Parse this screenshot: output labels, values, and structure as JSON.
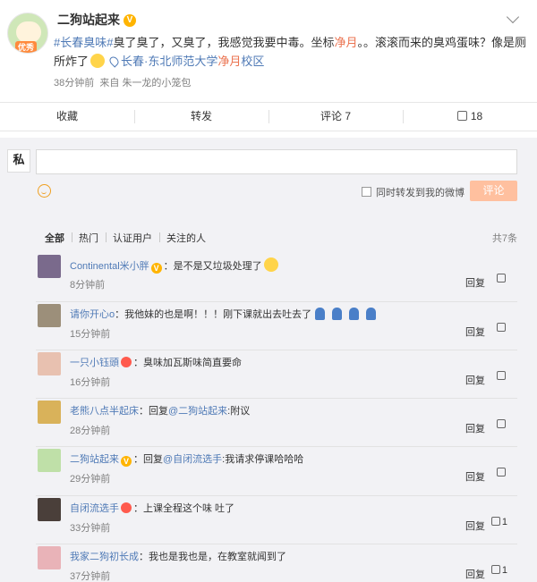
{
  "post": {
    "author": "二狗站起来",
    "verified_mark": "V",
    "avatar_tag": "优秀",
    "text_hashtag": "#长春臭味#",
    "text_1": "臭了臭了，又臭了，我感觉我要中毒。坐标",
    "text_hl": "净月",
    "text_2": "。。滚滚而来的臭鸡蛋味？像是厕所炸了",
    "location_a": "长春·东北师范大学",
    "location_b": "净月",
    "location_c": "校区",
    "time": "38分钟前",
    "source_prefix": "来自",
    "source": "朱一龙的小笼包"
  },
  "actions": {
    "favorite": "收藏",
    "repost": "转发",
    "comment": "评论 7",
    "like": "18"
  },
  "compose": {
    "my_avatar": "私",
    "placeholder": "",
    "also_repost": "同时转发到我的微博",
    "submit": "评论"
  },
  "comment_tabs": [
    "全部",
    "热门",
    "认证用户",
    "关注的人"
  ],
  "comment_total": "共7条",
  "comments": [
    {
      "name": "Continental米小胖",
      "badge": "V",
      "text": "：是不是又垃圾处理了",
      "time": "8分钟前",
      "reply": "回复",
      "likes": ""
    },
    {
      "name": "请你开心o",
      "badge": "",
      "text": "：我他妹的也是啊！！！刚下课就出去吐去了",
      "time": "15分钟前",
      "reply": "回复",
      "likes": ""
    },
    {
      "name": "一只小钰頭",
      "badge": "heart",
      "text": "：臭味加瓦斯味简直要命",
      "time": "16分钟前",
      "reply": "回复",
      "likes": ""
    },
    {
      "name": "老熊八点半起床",
      "badge": "",
      "text_pre": "：回复",
      "mention": "@二狗站起来",
      "text": ":附议",
      "time": "28分钟前",
      "reply": "回复",
      "likes": ""
    },
    {
      "name": "二狗站起来",
      "badge": "V",
      "text_pre": "：回复",
      "mention": "@自闭流选手",
      "text": ":我请求停课哈哈哈",
      "time": "29分钟前",
      "reply": "回复",
      "likes": ""
    },
    {
      "name": "自闭流选手",
      "badge": "heart",
      "text": "：上课全程这个味 吐了",
      "time": "33分钟前",
      "reply": "回复",
      "likes": "1"
    },
    {
      "name": "我家二狗初长成",
      "badge": "",
      "text": "：我也是我也是，在教室就闻到了",
      "time": "37分钟前",
      "reply": "回复",
      "likes": "1"
    }
  ],
  "colors": {
    "link": "#4f7ab6",
    "highlight": "#eb7350",
    "submit_bg": "#ffc09f",
    "panel_bg": "#f2f2f5"
  }
}
